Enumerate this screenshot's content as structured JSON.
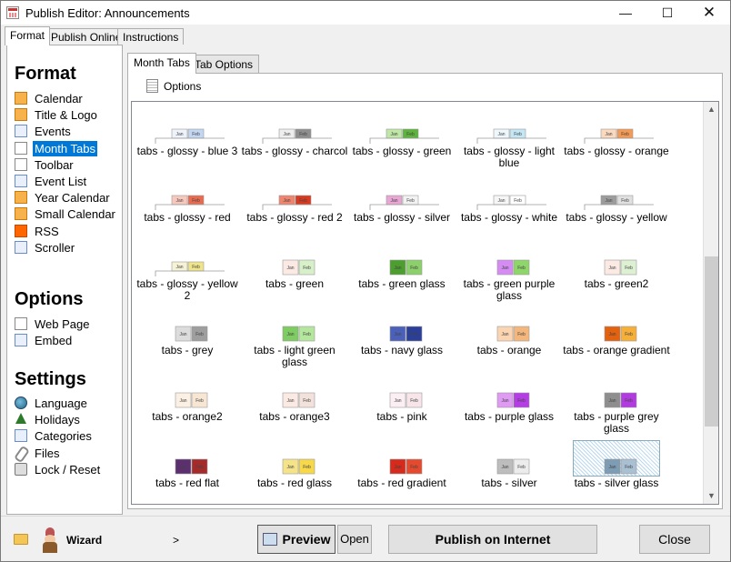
{
  "window": {
    "title": "Publish Editor: Announcements",
    "min": "—",
    "max": "☐",
    "close": "✕"
  },
  "top_tabs": [
    "Format",
    "Publish Online",
    "Instructions"
  ],
  "left": {
    "format_title": "Format",
    "format_items": [
      {
        "label": "Calendar",
        "icon": "calendar-icon"
      },
      {
        "label": "Title & Logo",
        "icon": "title-icon"
      },
      {
        "label": "Events",
        "icon": "events-icon"
      },
      {
        "label": "Month Tabs",
        "icon": "tabs-icon",
        "selected": true
      },
      {
        "label": "Toolbar",
        "icon": "toolbar-icon"
      },
      {
        "label": "Event List",
        "icon": "list-icon"
      },
      {
        "label": "Year Calendar",
        "icon": "year-icon"
      },
      {
        "label": "Small Calendar",
        "icon": "small-calendar-icon"
      },
      {
        "label": "RSS",
        "icon": "rss-icon"
      },
      {
        "label": "Scroller",
        "icon": "scroller-icon"
      }
    ],
    "options_title": "Options",
    "options_items": [
      {
        "label": "Web Page",
        "icon": "web-page-icon"
      },
      {
        "label": "Embed",
        "icon": "embed-icon"
      }
    ],
    "settings_title": "Settings",
    "settings_items": [
      {
        "label": "Language",
        "icon": "globe-icon"
      },
      {
        "label": "Holidays",
        "icon": "tree-icon"
      },
      {
        "label": "Categories",
        "icon": "categories-icon"
      },
      {
        "label": "Files",
        "icon": "paperclip-icon"
      },
      {
        "label": "Lock / Reset",
        "icon": "lock-icon"
      }
    ]
  },
  "inner_tabs": [
    "Month Tabs",
    "Tab Options"
  ],
  "options_label": "Options",
  "tab_sample": {
    "a": "Jan",
    "b": "Feb"
  },
  "styles": [
    {
      "label": "tabs - glossy - blue 3",
      "kind": "line",
      "ca": "#eef3fb",
      "cb": "#c3d6f2"
    },
    {
      "label": "tabs - glossy - charcol",
      "kind": "line",
      "ca": "#eeeeee",
      "cb": "#8e8e8e"
    },
    {
      "label": "tabs - glossy - green",
      "kind": "line",
      "ca": "#bfe7a5",
      "cb": "#5cb43c"
    },
    {
      "label": "tabs - glossy - light blue",
      "kind": "line",
      "ca": "#eef8fc",
      "cb": "#c4e7f5"
    },
    {
      "label": "tabs - glossy - orange",
      "kind": "line",
      "ca": "#fbd9bf",
      "cb": "#f39a55"
    },
    {
      "label": "tabs - glossy - red",
      "kind": "line",
      "ca": "#f8c8bd",
      "cb": "#ea6a4f"
    },
    {
      "label": "tabs - glossy - red 2",
      "kind": "line",
      "ca": "#f1846c",
      "cb": "#d93a1f"
    },
    {
      "label": "tabs - glossy - silver",
      "kind": "line",
      "ca": "#e9a6d4",
      "cb": "#f2f2f2"
    },
    {
      "label": "tabs - glossy - white",
      "kind": "line",
      "ca": "#f6f6f6",
      "cb": "#ffffff"
    },
    {
      "label": "tabs - glossy - yellow",
      "kind": "line",
      "ca": "#9c9c9c",
      "cb": "#e0e0e0"
    },
    {
      "label": "tabs - glossy - yellow 2",
      "kind": "line",
      "ca": "#f6f2d5",
      "cb": "#efe48a"
    },
    {
      "label": "tabs - green",
      "kind": "box",
      "ca": "#fbe9e3",
      "cb": "#d7f0c9"
    },
    {
      "label": "tabs - green glass",
      "kind": "box",
      "ca": "#4c9e2e",
      "cb": "#8bd06a"
    },
    {
      "label": "tabs - green purple glass",
      "kind": "box",
      "ca": "#d48cf2",
      "cb": "#8ed56a"
    },
    {
      "label": "tabs - green2",
      "kind": "box",
      "ca": "#fbe9e3",
      "cb": "#ddf1d2"
    },
    {
      "label": "tabs - grey",
      "kind": "box",
      "ca": "#dcdcdc",
      "cb": "#9e9e9e"
    },
    {
      "label": "tabs - light green glass",
      "kind": "box",
      "ca": "#7fcc63",
      "cb": "#b4e69e"
    },
    {
      "label": "tabs - navy glass",
      "kind": "box",
      "ca": "#4b61b9",
      "cb": "#2b3f99"
    },
    {
      "label": "tabs - orange",
      "kind": "box",
      "ca": "#fbd4b1",
      "cb": "#f3b67c"
    },
    {
      "label": "tabs - orange gradient",
      "kind": "box",
      "ca": "#e2620f",
      "cb": "#f6b03a"
    },
    {
      "label": "tabs - orange2",
      "kind": "box",
      "ca": "#fbf0e3",
      "cb": "#f7e6d3"
    },
    {
      "label": "tabs - orange3",
      "kind": "box",
      "ca": "#fbe9e3",
      "cb": "#f3e2dc"
    },
    {
      "label": "tabs - pink",
      "kind": "box",
      "ca": "#fbeff3",
      "cb": "#f7e5ea"
    },
    {
      "label": "tabs - purple glass",
      "kind": "box",
      "ca": "#df9bf3",
      "cb": "#b43ee3"
    },
    {
      "label": "tabs - purple grey glass",
      "kind": "box",
      "ca": "#8e8e8e",
      "cb": "#b23be0"
    },
    {
      "label": "tabs - red flat",
      "kind": "box",
      "ca": "#5c2f6f",
      "cb": "#a52a2a"
    },
    {
      "label": "tabs - red glass",
      "kind": "box",
      "ca": "#f5e38a",
      "cb": "#f7d84a"
    },
    {
      "label": "tabs - red gradient",
      "kind": "box",
      "ca": "#d52a1c",
      "cb": "#e54a2f"
    },
    {
      "label": "tabs - silver",
      "kind": "box",
      "ca": "#bdbdbd",
      "cb": "#ececec"
    },
    {
      "label": "tabs - silver glass",
      "kind": "box",
      "ca": "#7e9db5",
      "cb": "#a9c0d3",
      "selected": true
    }
  ],
  "bottom": {
    "wizard_label": "Wizard",
    "wizard_arrow": ">",
    "preview_label": "Preview",
    "open_label": "Open",
    "publish_label": "Publish on Internet",
    "close_label": "Close"
  }
}
